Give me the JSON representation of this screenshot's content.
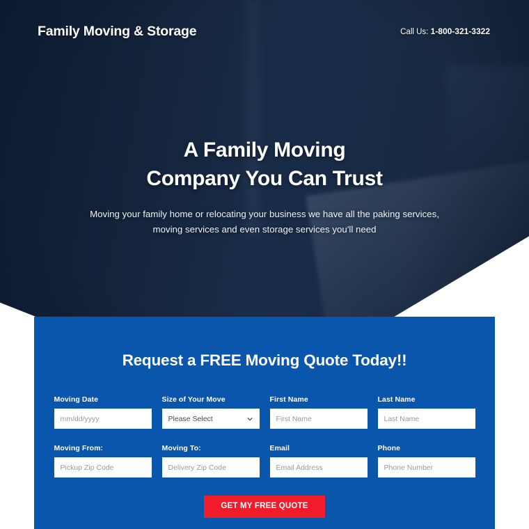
{
  "header": {
    "brand": "Family Moving & Storage",
    "call_label": "Call Us:",
    "phone": "1-800-321-3322"
  },
  "hero": {
    "title_line1": "A Family Moving",
    "title_line2": "Company You Can Trust",
    "subtitle_line1": "Moving your family home or relocating your business we have all the paking services,",
    "subtitle_line2": "moving services and even storage services you'll need"
  },
  "form": {
    "title": "Request a FREE Moving Quote Today!!",
    "fields": [
      {
        "label": "Moving Date",
        "placeholder": "mm/dd/yyyy",
        "type": "text"
      },
      {
        "label": "Size of Your Move",
        "placeholder": "Please Select",
        "type": "select"
      },
      {
        "label": "First Name",
        "placeholder": "First Name",
        "type": "text"
      },
      {
        "label": "Last Name",
        "placeholder": "Last Name",
        "type": "text"
      },
      {
        "label": "Moving From:",
        "placeholder": "Pickup Zip Code",
        "type": "text"
      },
      {
        "label": "Moving To:",
        "placeholder": "Delivery Zip Code",
        "type": "text"
      },
      {
        "label": "Email",
        "placeholder": "Email Address",
        "type": "text"
      },
      {
        "label": "Phone",
        "placeholder": "Phone Number",
        "type": "text"
      }
    ],
    "select_value": "Please Select",
    "submit_label": "GET MY FREE QUOTE"
  },
  "colors": {
    "panel_blue": "#0a56ad",
    "cta_red": "#f01c2b",
    "hero_navy": "#16283f",
    "text_white": "#ffffff"
  },
  "icons": {
    "chevron_down": "chevron-down-icon"
  }
}
